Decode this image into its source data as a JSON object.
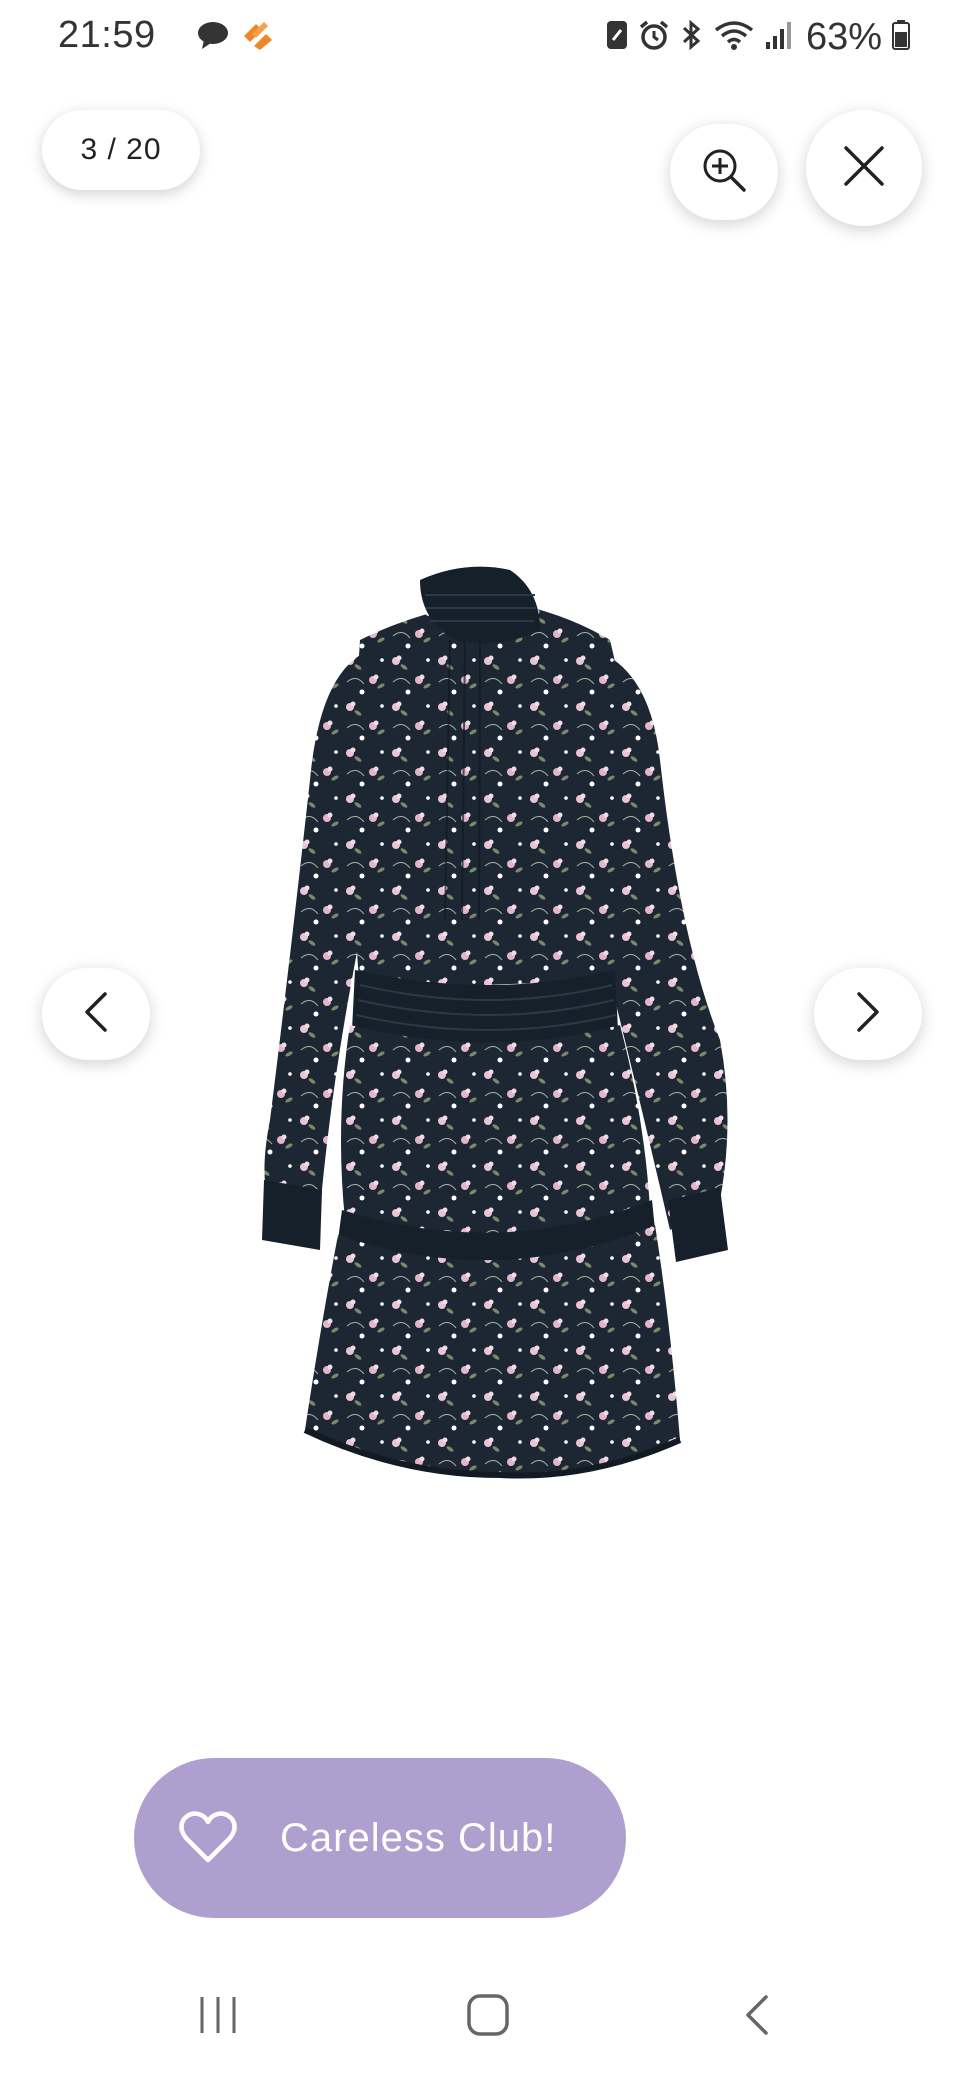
{
  "status_bar": {
    "time": "21:59",
    "battery_percent": "63%",
    "left_icons": [
      "chat-bubble-icon",
      "app-logo-icon"
    ],
    "right_icons": [
      "nfc-icon",
      "alarm-icon",
      "bluetooth-icon",
      "wifi-icon",
      "signal-icon",
      "battery-icon"
    ]
  },
  "gallery": {
    "counter": "3 / 20",
    "zoom_icon": "zoom-in-icon",
    "close_icon": "close-icon",
    "prev_icon": "chevron-left-icon",
    "next_icon": "chevron-right-icon",
    "image": "floral-print-dress",
    "dress_colors": {
      "base": "#1c2733",
      "flower_pink": "#e8c4d4",
      "leaf_green": "#7a8a66"
    }
  },
  "club_button": {
    "label": "Careless Club!",
    "icon": "heart-icon",
    "color": "#ae9fce"
  },
  "nav_bar": {
    "items": [
      "recent-apps-icon",
      "home-icon",
      "back-icon"
    ]
  }
}
